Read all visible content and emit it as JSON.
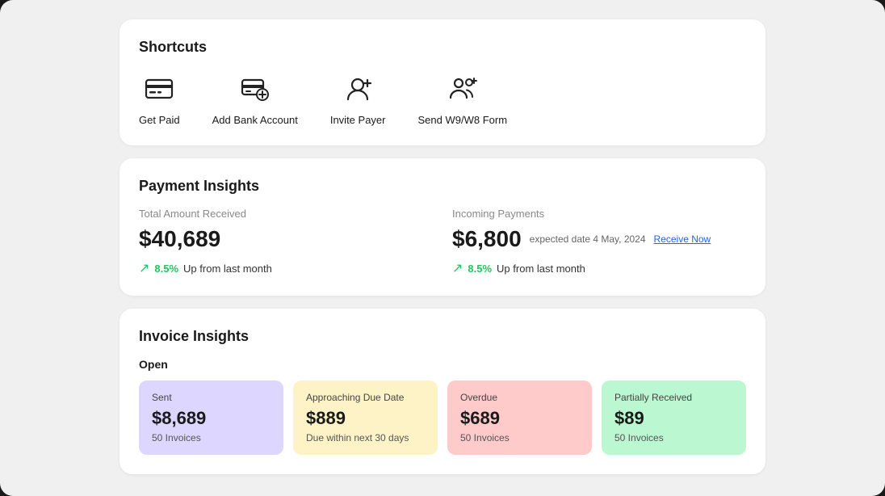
{
  "shortcuts": {
    "title": "Shortcuts",
    "items": [
      {
        "id": "get-paid",
        "label": "Get Paid"
      },
      {
        "id": "add-bank-account",
        "label": "Add Bank Account"
      },
      {
        "id": "invite-payer",
        "label": "Invite Payer"
      },
      {
        "id": "send-w9w8",
        "label": "Send W9/W8 Form"
      }
    ]
  },
  "payment_insights": {
    "title": "Payment Insights",
    "total_received": {
      "label": "Total Amount Received",
      "amount": "$40,689",
      "trend_percent": "8.5%",
      "trend_text": "Up from last month"
    },
    "incoming": {
      "label": "Incoming Payments",
      "amount": "$6,800",
      "expected_text": "expected date 4 May, 2024",
      "receive_now_label": "Receive Now",
      "trend_percent": "8.5%",
      "trend_text": "Up from last month"
    }
  },
  "invoice_insights": {
    "title": "Invoice Insights",
    "open_label": "Open",
    "cards": [
      {
        "id": "sent",
        "label": "Sent",
        "amount": "$8,689",
        "sub": "50 Invoices",
        "color_class": "card-sent"
      },
      {
        "id": "approaching",
        "label": "Approaching Due Date",
        "amount": "$889",
        "sub": "Due within next 30 days",
        "color_class": "card-approaching"
      },
      {
        "id": "overdue",
        "label": "Overdue",
        "amount": "$689",
        "sub": "50 Invoices",
        "color_class": "card-overdue"
      },
      {
        "id": "partial",
        "label": "Partially Received",
        "amount": "$89",
        "sub": "50 Invoices",
        "color_class": "card-partial"
      }
    ]
  }
}
